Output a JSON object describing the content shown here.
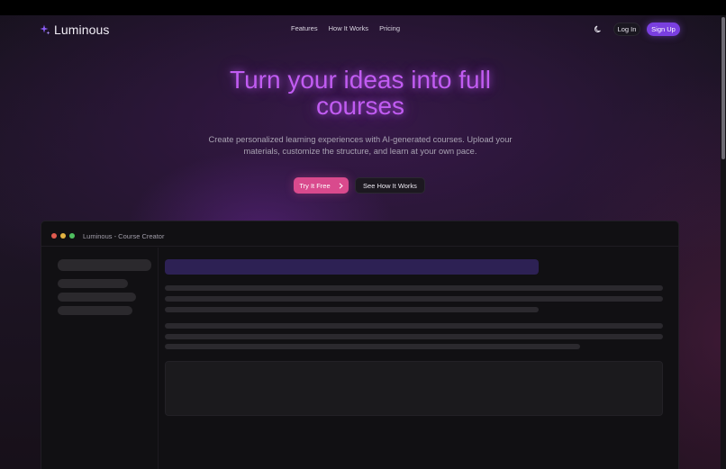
{
  "brand": {
    "name": "Luminous",
    "icon": "sparkle-icon",
    "accent": "#8b5cf6"
  },
  "nav": {
    "links": [
      "Features",
      "How It Works",
      "Pricing"
    ],
    "theme_toggle_icon": "moon-icon",
    "login_label": "Log In",
    "signup_label": "Sign Up"
  },
  "hero": {
    "title_line1": "Turn your ideas into full",
    "title_line2": "courses",
    "subtitle_line1": "Create personalized learning experiences with AI-generated courses. Upload your",
    "subtitle_line2": "materials, customize the structure, and learn at your own pace.",
    "primary_cta": "Try It Free",
    "primary_cta_icon": "chevron-right-icon",
    "secondary_cta": "See How It Works"
  },
  "preview_window": {
    "title": "Luminous - Course Creator",
    "traffic_light_colors": [
      "#e05a4f",
      "#e3b341",
      "#4fbf5f"
    ]
  },
  "colors": {
    "title_glow": "#c15cf2",
    "signup_bg": "#7a3fe0",
    "primary_cta_bg": "#d94a8d",
    "placeholder_header": "#2d2154"
  }
}
